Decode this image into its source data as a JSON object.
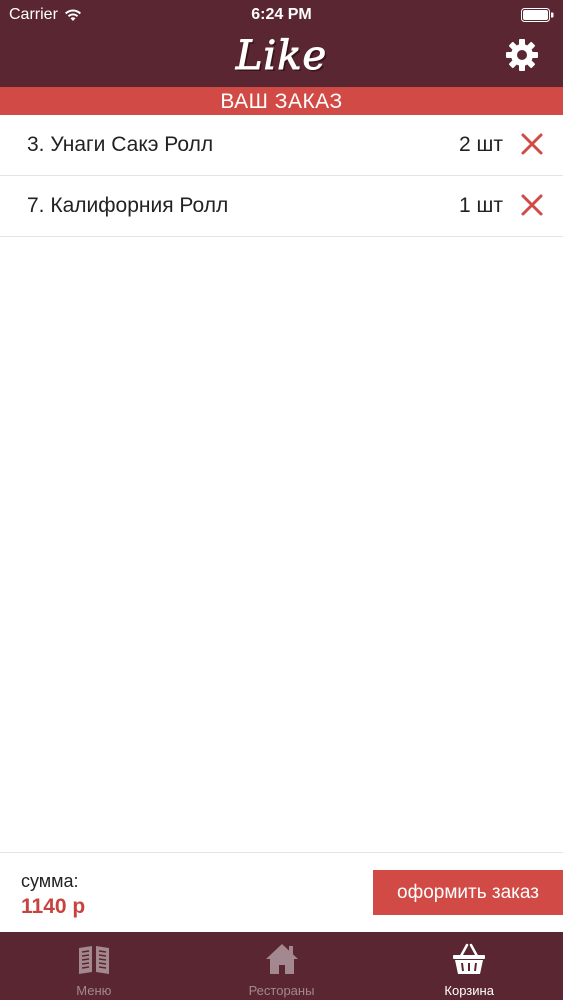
{
  "status_bar": {
    "carrier": "Carrier",
    "time": "6:24 PM"
  },
  "header": {
    "logo": "Like"
  },
  "banner": {
    "title": "ВАШ ЗАКАЗ"
  },
  "orders": [
    {
      "name": "3. Унаги Сакэ Ролл",
      "qty": "2 шт"
    },
    {
      "name": "7. Калифорния Ролл",
      "qty": "1 шт"
    }
  ],
  "summary": {
    "label": "сумма:",
    "value": "1140 р",
    "checkout_label": "оформить заказ"
  },
  "tabs": [
    {
      "label": "Меню",
      "icon": "menu-book-icon",
      "active": false
    },
    {
      "label": "Рестораны",
      "icon": "home-icon",
      "active": false
    },
    {
      "label": "Корзина",
      "icon": "basket-icon",
      "active": true
    }
  ],
  "colors": {
    "header_bg": "#592631",
    "accent": "#d24a45",
    "price": "#c9423d",
    "tab_inactive": "#a38890"
  }
}
